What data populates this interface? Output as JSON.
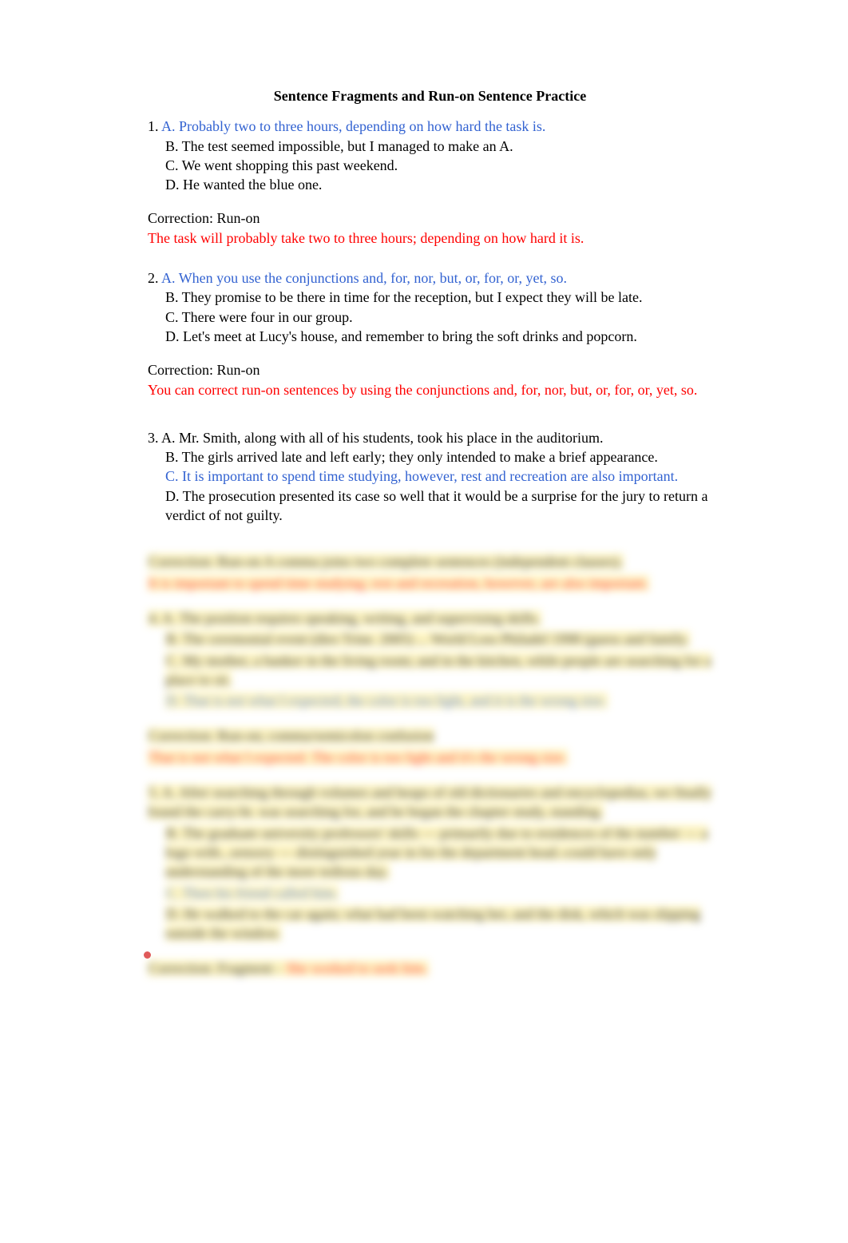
{
  "title": "Sentence Fragments and Run-on Sentence Practice",
  "q1": {
    "num": "1. ",
    "a": "A. Probably two to three hours, depending on how hard the task is.",
    "b": "B. The test seemed impossible, but I managed to make an A.",
    "c": "C. We went shopping this past weekend.",
    "d": "D. He wanted the blue one.",
    "corrLabel": "Correction:  Run-on",
    "corrText": "The task will probably take two to three hours; depending on how hard it is."
  },
  "q2": {
    "num": "2. ",
    "a": "A. When you use the conjunctions and, for, nor, but, or, for, or, yet, so.",
    "b": "B. They promise to be there in time for the reception, but I expect they will be late.",
    "c": "C. There were four in our group.",
    "d": "D. Let's meet at Lucy's house, and remember to bring the soft drinks and popcorn.",
    "corrLabel": "Correction: Run-on",
    "corrText": "You can correct run-on sentences by using the conjunctions and, for, nor, but, or, for, or, yet, so."
  },
  "q3": {
    "num": "3. ",
    "a": "A. Mr. Smith, along with all of his students, took his place in the auditorium.",
    "b": "B. The girls arrived late and left early; they only intended to make a brief appearance.",
    "c": "C. It is important to spend time studying, however, rest and recreation are also important.",
    "d": "D. The prosecution presented its case so well that it would be a surprise for the jury to return a verdict of not guilty."
  },
  "hidden": {
    "l1a": "Correction: Run-on  A comma joins two complete sentences (independent clauses).",
    "l1b": "It is important to spend time studying; rest and recreation, however, are also important.",
    "q4num": "4. ",
    "q4a": "A. The position requires speaking, writing, and supervising skills.",
    "q4b": "B. The ceremonial event (dies Trine. 2005) ... World Loss Philadel 1998 (guess and family.",
    "q4c": "C. My mother, a banker in the living room; and in the kitchen, while people are searching for a place to sit.",
    "q4d": "D. That is not what I expected; the color is too light, and it is the wrong size.",
    "c4a": "Correction: Run-on; comma/semicolon confusion",
    "c4b": "That is not what I expected. The color is too light and it's the wrong size.",
    "q5num": "5. ",
    "q5a": "A. After searching through volumes and heaps of old dictionaries and encyclopedias, we finally found the carry-bt. was searching for,  and be began the chapter study, standing.",
    "q5b": "B. The graduate university professors' skills — primarily   due to residences of the number — a logo with...sensory — distinguished year in for the department head.-could have only understanding of the more tedious day.",
    "q5c": "C. Then his friend called him.",
    "q5d": "D. He walked to the car again; what had been watching her, and the disk, which was slipping outside the window.",
    "c5a": "Correction: Fragment - ",
    "c5b": "She worked to seek him."
  }
}
